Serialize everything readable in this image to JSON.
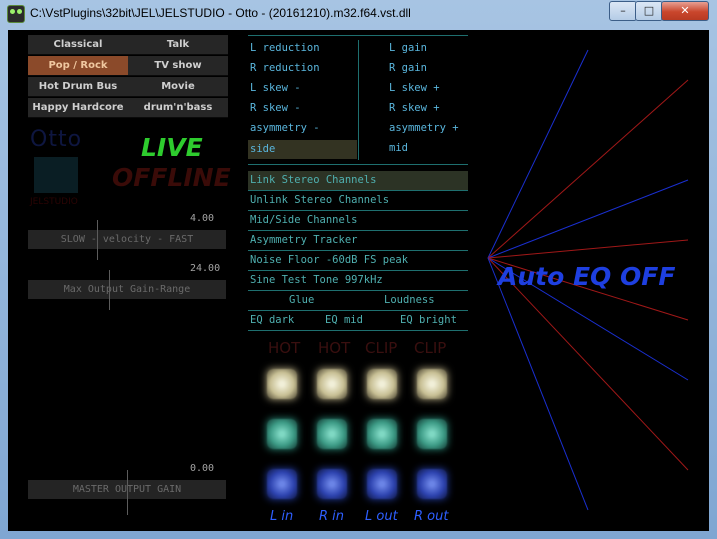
{
  "window": {
    "title": "C:\\VstPlugins\\32bit\\JEL\\JELSTUDIO - Otto - (20161210).m32.f64.vst.dll",
    "minimize": "–",
    "maximize": "□",
    "close": "✕"
  },
  "presets": [
    {
      "label": "Classical",
      "active": false
    },
    {
      "label": "Talk",
      "active": false
    },
    {
      "label": "Pop / Rock",
      "active": true
    },
    {
      "label": "TV show",
      "active": false
    },
    {
      "label": "Hot Drum Bus",
      "active": false
    },
    {
      "label": "Movie",
      "active": false
    },
    {
      "label": "Happy Hardcore",
      "active": false
    },
    {
      "label": "drum'n'bass",
      "active": false
    }
  ],
  "logo": {
    "name": "Otto",
    "subtitle": "JELSTUDIO"
  },
  "status": {
    "live": "LIVE",
    "offline": "OFFLINE"
  },
  "velocity": {
    "value": "4.00",
    "label": "SLOW - velocity - FAST",
    "fraction": 0.35
  },
  "gain_range": {
    "value": "24.00",
    "label": "Max Output Gain-Range",
    "fraction": 0.41
  },
  "master_gain": {
    "value": "0.00",
    "label": "MASTER OUTPUT GAIN",
    "fraction": 0.5
  },
  "mode_left": [
    {
      "label": "L reduction",
      "selected": false
    },
    {
      "label": "R reduction",
      "selected": false
    },
    {
      "label": "L skew -",
      "selected": false
    },
    {
      "label": "R skew -",
      "selected": false
    },
    {
      "label": "asymmetry -",
      "selected": false
    },
    {
      "label": "side",
      "selected": true
    }
  ],
  "mode_right": [
    {
      "label": "L gain",
      "selected": false
    },
    {
      "label": "R gain",
      "selected": false
    },
    {
      "label": "L skew +",
      "selected": false
    },
    {
      "label": "R skew +",
      "selected": false
    },
    {
      "label": "asymmetry +",
      "selected": false
    },
    {
      "label": "mid",
      "selected": false
    }
  ],
  "options": [
    {
      "label": "Link Stereo Channels",
      "selected": true
    },
    {
      "label": "Unlink Stereo Channels",
      "selected": false
    },
    {
      "label": "Mid/Side Channels",
      "selected": false
    },
    {
      "label": "Asymmetry Tracker",
      "selected": false
    },
    {
      "label": "Noise Floor -60dB FS peak",
      "selected": false
    },
    {
      "label": "Sine Test Tone 997kHz",
      "selected": false
    }
  ],
  "glue": "Glue",
  "loudness": "Loudness",
  "eq": {
    "dark": "EQ dark",
    "mid": "EQ mid",
    "bright": "EQ bright"
  },
  "meters": {
    "indicators": [
      "HOT",
      "HOT",
      "CLIP",
      "CLIP"
    ],
    "channels": [
      "L in",
      "R in",
      "L out",
      "R out"
    ]
  },
  "auto_eq": "Auto EQ OFF",
  "colors": {
    "live": "#2ecc2e",
    "accent": "#5ab6dd",
    "auto_eq": "#1e3fe0",
    "preset_active": "#8b4a2a"
  }
}
